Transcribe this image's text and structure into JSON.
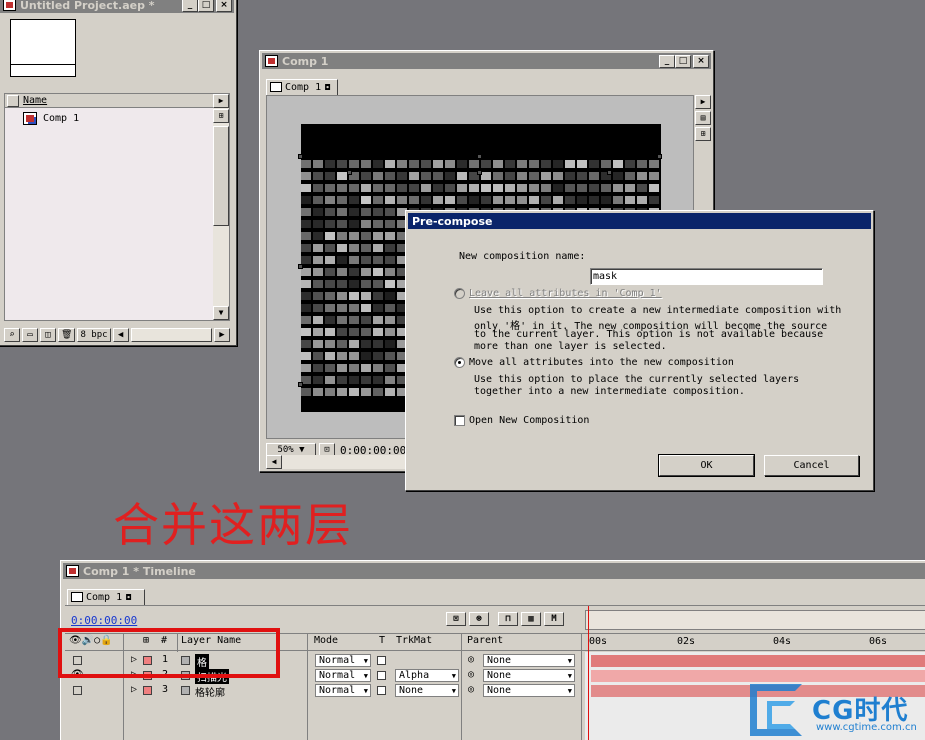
{
  "project": {
    "title": "Untitled Project.aep *",
    "column_name": "Name",
    "items": [
      {
        "name": "Comp 1"
      }
    ],
    "footer": {
      "bpc": "8 bpc"
    }
  },
  "comp_viewer": {
    "title": "Comp 1",
    "tab": "Comp 1",
    "zoom": "50%",
    "timecode": "0:00:00:00"
  },
  "precompose": {
    "title": "Pre-compose",
    "name_label": "New composition name:",
    "name_value": "mask",
    "option1_label": "Leave all attributes in 'Comp 1'",
    "option1_desc_lines": [
      "Use this option to create a new intermediate composition with",
      "only '格' in it.  The new composition will become the source",
      "to the current layer.  This option is not available because",
      "more than one layer is selected."
    ],
    "option2_label": "Move all attributes into the new composition",
    "option2_desc_lines": [
      "Use this option to place the currently selected layers",
      "together into a new intermediate composition."
    ],
    "open_new_label": "Open New Composition",
    "ok_label": "OK",
    "cancel_label": "Cancel"
  },
  "annotation": {
    "text": "合并这两层",
    "color": "#e02020"
  },
  "timeline": {
    "title": "Comp 1 * Timeline",
    "tab": "Comp 1",
    "timecode": "0:00:00:00",
    "headers": {
      "hash": "#",
      "layer_name": "Layer Name",
      "mode": "Mode",
      "t": "T",
      "trkmat": "TrkMat",
      "parent": "Parent"
    },
    "ruler": [
      "00s",
      "02s",
      "04s",
      "06s"
    ],
    "layers": [
      {
        "num": "1",
        "name": "格",
        "mode": "Normal",
        "trkmat": "",
        "parent": "None"
      },
      {
        "num": "2",
        "name": "扫描光",
        "mode": "Normal",
        "trkmat": "Alpha",
        "parent": "None"
      },
      {
        "num": "3",
        "name": "格轮廓",
        "mode": "Normal",
        "trkmat": "None",
        "parent": "None"
      }
    ]
  },
  "logo": {
    "brand": "CG时代",
    "url": "www.cgtime.com.cn"
  },
  "colors": {
    "accent": "#0a246a",
    "highlight": "#e01010",
    "layer_bar": "#e07a7a"
  }
}
